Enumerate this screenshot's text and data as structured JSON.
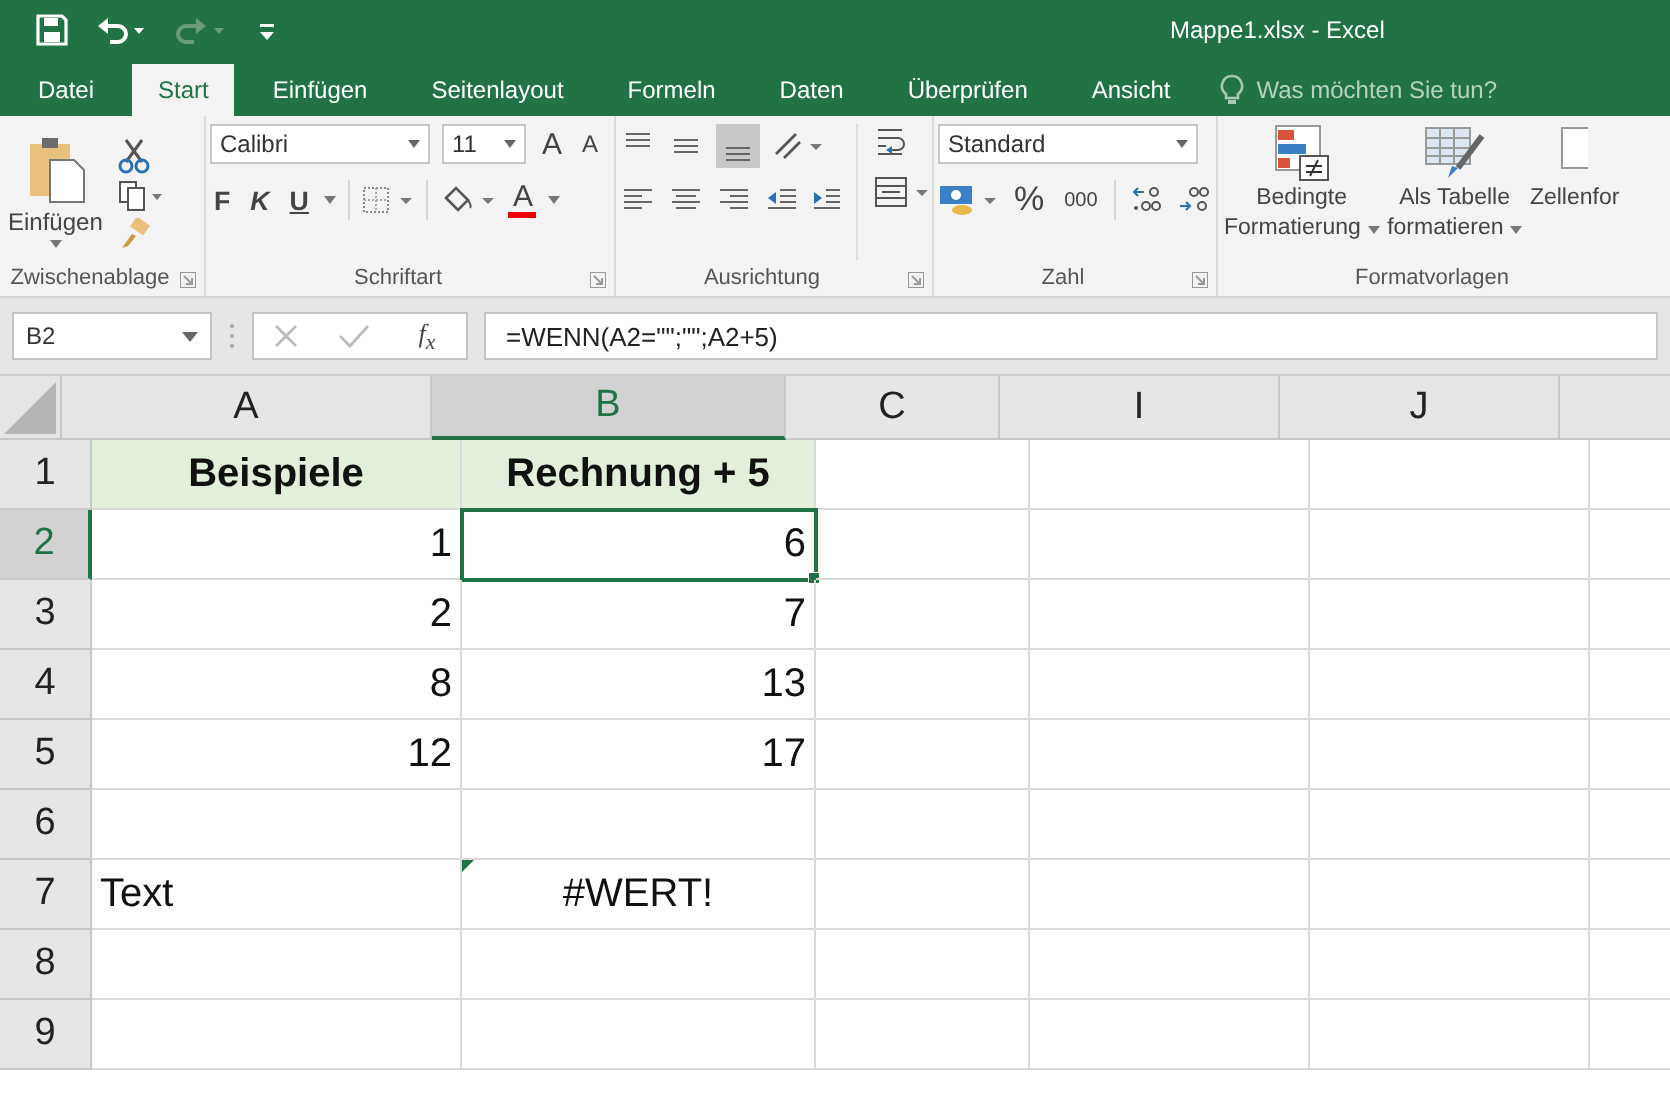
{
  "title_bar": {
    "title": "Mappe1.xlsx - Excel"
  },
  "tabs": [
    {
      "label": "Datei",
      "selected": false
    },
    {
      "label": "Start",
      "selected": true
    },
    {
      "label": "Einfügen",
      "selected": false
    },
    {
      "label": "Seitenlayout",
      "selected": false
    },
    {
      "label": "Formeln",
      "selected": false
    },
    {
      "label": "Daten",
      "selected": false
    },
    {
      "label": "Überprüfen",
      "selected": false
    },
    {
      "label": "Ansicht",
      "selected": false
    }
  ],
  "tell_me": {
    "placeholder": "Was möchten Sie tun?"
  },
  "ribbon": {
    "clipboard": {
      "paste_label": "Einfügen",
      "group_label": "Zwischenablage"
    },
    "font": {
      "font_name": "Calibri",
      "font_size": "11",
      "grow_label": "A",
      "shrink_label": "A",
      "bold_label": "F",
      "italic_label": "K",
      "underline_label": "U",
      "color_label": "A",
      "group_label": "Schriftart"
    },
    "alignment": {
      "group_label": "Ausrichtung"
    },
    "number": {
      "format": "Standard",
      "percent_label": "%",
      "thousands_label": "000",
      "group_label": "Zahl"
    },
    "styles": {
      "buttons": [
        {
          "line_1": "Bedingte",
          "line_2": "Formatierung"
        },
        {
          "line_1": "Als Tabelle",
          "line_2": "formatieren"
        },
        {
          "line_1": "Zellenfor"
        }
      ],
      "group_label": "Formatvorlagen"
    }
  },
  "formula_bar": {
    "name_box": "B2",
    "fx": "f$_{x}$",
    "formula": "=WENN(A2=\"\";\"\";A2+5)"
  },
  "sheet": {
    "columns": [
      {
        "label": "A",
        "selected": false
      },
      {
        "label": "B",
        "selected": true
      },
      {
        "label": "C",
        "selected": false
      },
      {
        "label": "I",
        "selected": false
      },
      {
        "label": "J",
        "selected": false
      }
    ],
    "rows": [
      {
        "number": "1",
        "selected": false,
        "cells": [
          {
            "text": "Beispiele",
            "kind": "header",
            "selected": false
          },
          {
            "text": "Rechnung + 5",
            "kind": "header",
            "selected": false
          }
        ]
      },
      {
        "number": "2",
        "selected": true,
        "cells": [
          {
            "text": "1",
            "kind": "number",
            "selected": false
          },
          {
            "text": "6",
            "kind": "number",
            "selected": true
          }
        ]
      },
      {
        "number": "3",
        "selected": false,
        "cells": [
          {
            "text": "2",
            "kind": "number",
            "selected": false
          },
          {
            "text": "7",
            "kind": "number",
            "selected": false
          }
        ]
      },
      {
        "number": "4",
        "selected": false,
        "cells": [
          {
            "text": "8",
            "kind": "number",
            "selected": false
          },
          {
            "text": "13",
            "kind": "number",
            "selected": false
          }
        ]
      },
      {
        "number": "5",
        "selected": false,
        "cells": [
          {
            "text": "12",
            "kind": "number",
            "selected": false
          },
          {
            "text": "17",
            "kind": "number",
            "selected": false
          }
        ]
      },
      {
        "number": "6",
        "selected": false
      },
      {
        "number": "7",
        "selected": false,
        "cells": [
          {
            "text": "Text",
            "kind": "text",
            "selected": false
          },
          {
            "text": "#WERT!",
            "kind": "error",
            "selected": false,
            "error_flag": true
          }
        ]
      },
      {
        "number": "8",
        "selected": false
      },
      {
        "number": "9",
        "selected": false
      }
    ]
  }
}
